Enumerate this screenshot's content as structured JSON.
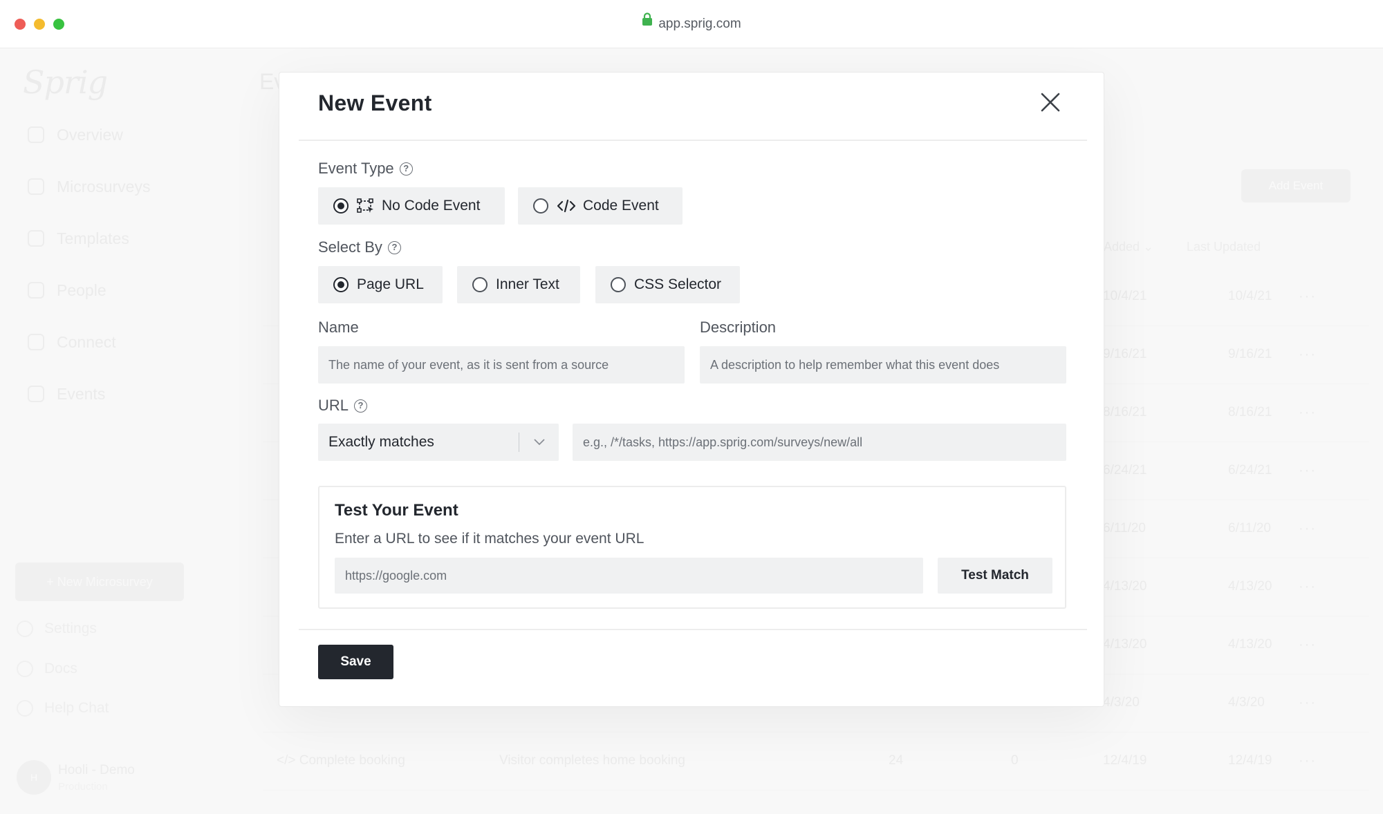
{
  "browser": {
    "url": "app.sprig.com"
  },
  "app": {
    "logo": "Sprig",
    "nav": [
      "Overview",
      "Microsurveys",
      "Templates",
      "People",
      "Connect",
      "Events"
    ],
    "new_survey_label": "+ New Microsurvey",
    "bottom_nav": [
      "Settings",
      "Docs",
      "Help Chat"
    ],
    "account": {
      "initials": "H",
      "name": "Hooli - Demo",
      "env": "Production"
    },
    "page_title": "Ev",
    "add_event_label": "Add Event",
    "columns": {
      "added": "Added ⌄",
      "last_updated": "Last Updated"
    },
    "rows": [
      {
        "added": "10/4/21",
        "updated": "10/4/21"
      },
      {
        "added": "9/16/21",
        "updated": "9/16/21"
      },
      {
        "added": "8/16/21",
        "updated": "8/16/21"
      },
      {
        "added": "6/24/21",
        "updated": "6/24/21"
      },
      {
        "added": "6/11/20",
        "updated": "6/11/20"
      },
      {
        "added": "4/13/20",
        "updated": "4/13/20"
      },
      {
        "added": "4/13/20",
        "updated": "4/13/20"
      },
      {
        "added": "4/3/20",
        "updated": "4/3/20"
      },
      {
        "name": "</> Complete booking",
        "description": "Visitor completes home booking",
        "count": "24",
        "users": "0",
        "added": "12/4/19",
        "updated": "12/4/19"
      }
    ]
  },
  "modal": {
    "title": "New Event",
    "event_type": {
      "label": "Event Type",
      "options": [
        {
          "label": "No Code Event",
          "selected": true
        },
        {
          "label": "Code Event",
          "selected": false
        }
      ]
    },
    "select_by": {
      "label": "Select By",
      "options": [
        {
          "label": "Page URL",
          "selected": true
        },
        {
          "label": "Inner Text",
          "selected": false
        },
        {
          "label": "CSS Selector",
          "selected": false
        }
      ]
    },
    "name": {
      "label": "Name",
      "placeholder": "The name of your event, as it is sent from a source",
      "value": ""
    },
    "description": {
      "label": "Description",
      "placeholder": "A description to help remember what this event does",
      "value": ""
    },
    "url": {
      "label": "URL",
      "match_type": "Exactly matches",
      "placeholder": "e.g., /*/tasks, https://app.sprig.com/surveys/new/all",
      "value": ""
    },
    "test": {
      "title": "Test Your Event",
      "subtitle": "Enter a URL to see if it matches your event URL",
      "placeholder": "https://google.com",
      "button": "Test Match"
    },
    "save_label": "Save"
  }
}
